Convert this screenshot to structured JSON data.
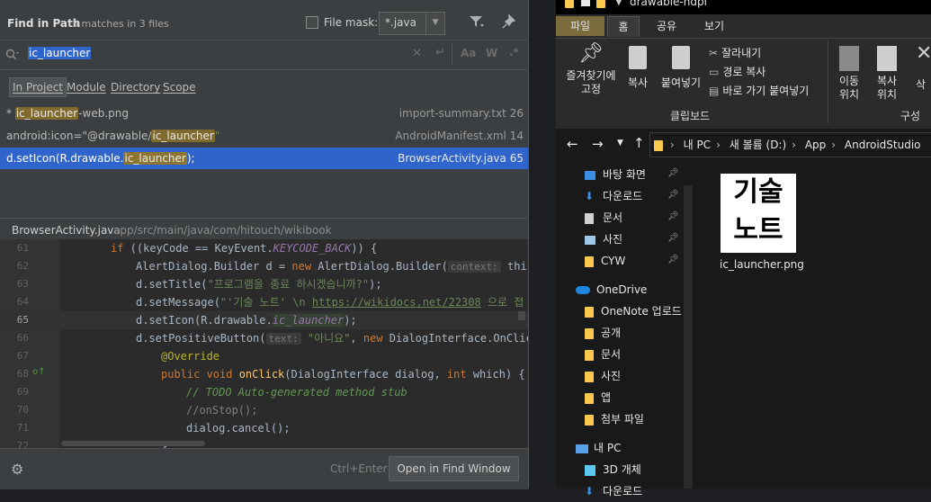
{
  "find": {
    "title": "Find in Path",
    "match_info": "3 matches in 3 files",
    "file_mask_label": "File mask:",
    "file_mask_value": "*.java",
    "query": "ic_launcher",
    "search_options": [
      "Aa",
      "W",
      ".*"
    ],
    "scopes": [
      "In Project",
      "Module",
      "Directory",
      "Scope"
    ],
    "results": [
      {
        "pre": "* ",
        "match": "ic_launcher",
        "post": "-web.png",
        "file": "import-summary.txt",
        "line": "26"
      },
      {
        "pre": "android:icon=\"@drawable/",
        "match": "ic_launcher",
        "post": "\"",
        "file": "AndroidManifest.xml",
        "line": "14"
      },
      {
        "pre": "d.setIcon(R.drawable.",
        "match": "ic_launcher",
        "post": ");",
        "file": "BrowserActivity.java",
        "line": "65"
      }
    ],
    "preview_file": "BrowserActivity.java",
    "preview_path": "app/src/main/java/com/hitouch/wikibook",
    "shortcut": "Ctrl+Enter",
    "open_button": "Open in Find Window"
  },
  "code": {
    "line_numbers": [
      "61",
      "62",
      "63",
      "64",
      "65",
      "66",
      "67",
      "68",
      "69",
      "70",
      "71",
      "72"
    ],
    "l61": {
      "a": "if ((keyCode == KeyEvent.",
      "b": "KEYCODE_BACK",
      "c": ")) {"
    },
    "l62": {
      "a": "AlertDialog.Builder d = ",
      "new": "new",
      "b": " AlertDialog.Builder(",
      "hint": "context:",
      "c": " this);"
    },
    "l63": {
      "a": "d.setTitle(",
      "s": "\"프로그램을 종료 하시겠습니까?\"",
      "c": ");"
    },
    "l64": {
      "a": "d.setMessage(",
      "s": "\"'기술 노트' \\n ",
      "u": "https://wikidocs.net/22308",
      "s2": " 으로 접"
    },
    "l65": {
      "a": "d.setIcon(R.drawable.",
      "b": "ic_launcher",
      "c": ");"
    },
    "l66": {
      "a": "d.setPositiveButton(",
      "hint": "text:",
      "s": " \"아니요\"",
      "c": ", ",
      "new": "new",
      "d": " DialogInterface.OnClick"
    },
    "l67": {
      "a": "@Override"
    },
    "l68": {
      "kw": "public void ",
      "fn": "onClick",
      "a": "(DialogInterface dialog, ",
      "kw2": "int",
      "b": " which) {"
    },
    "l69": {
      "a": "// TODO Auto-generated method stub"
    },
    "l70": {
      "a": "//onStop();"
    },
    "l71": {
      "a": "dialog.cancel();"
    },
    "l72": {
      "a": "}"
    },
    "gutter_icon_label": "기술\n노트"
  },
  "explorer": {
    "window_title": "drawable-hdpi",
    "tabs": [
      "파일",
      "홈",
      "공유",
      "보기"
    ],
    "ribbon": {
      "pin": "즐겨찾기에 고정",
      "copy": "복사",
      "paste": "붙여넣기",
      "cut": "잘라내기",
      "copy_path": "경로 복사",
      "paste_shortcut": "바로 가기 붙여넣기",
      "clipboard": "클립보드",
      "move": "이동 위치",
      "copy_to": "복사 위치",
      "organize": "구성",
      "delete": "삭"
    },
    "breadcrumb": [
      "내 PC",
      "새 볼륨 (D:)",
      "App",
      "AndroidStudio"
    ],
    "nav": [
      {
        "label": "바탕 화면",
        "pinned": true
      },
      {
        "label": "다운로드",
        "pinned": true
      },
      {
        "label": "문서",
        "pinned": true
      },
      {
        "label": "사진",
        "pinned": true
      },
      {
        "label": "CYW",
        "pinned": true
      },
      {
        "label": "OneDrive",
        "pinned": false
      },
      {
        "label": "OneNote 업로드",
        "pinned": false
      },
      {
        "label": "공개",
        "pinned": false
      },
      {
        "label": "문서",
        "pinned": false
      },
      {
        "label": "사진",
        "pinned": false
      },
      {
        "label": "앱",
        "pinned": false
      },
      {
        "label": "첨부 파일",
        "pinned": false
      },
      {
        "label": "내 PC",
        "pinned": false
      },
      {
        "label": "3D 개체",
        "pinned": false
      },
      {
        "label": "다운로드",
        "pinned": false
      }
    ],
    "file": {
      "name": "ic_launcher.png",
      "thumb_line1": "기술",
      "thumb_line2": "노트"
    }
  }
}
